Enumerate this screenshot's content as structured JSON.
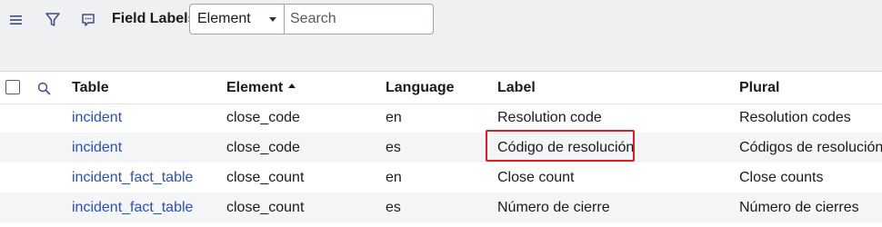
{
  "toolbar": {
    "menu_icon": "hamburger-menu-icon",
    "filter_icon": "funnel-filter-icon",
    "comment_icon": "comment-icon",
    "title": "Field Labels",
    "field_select_value": "Element",
    "search_placeholder": "Search"
  },
  "table": {
    "columns": [
      "Table",
      "Element",
      "Language",
      "Label",
      "Plural"
    ],
    "sort_column": "Element",
    "sort_direction": "ascending",
    "rows": [
      {
        "table": "incident",
        "element": "close_code",
        "language": "en",
        "label": "Resolution code",
        "plural": "Resolution codes"
      },
      {
        "table": "incident",
        "element": "close_code",
        "language": "es",
        "label": "Código de resolución",
        "plural": "Códigos de resolución"
      },
      {
        "table": "incident_fact_table",
        "element": "close_count",
        "language": "en",
        "label": "Close count",
        "plural": "Close counts"
      },
      {
        "table": "incident_fact_table",
        "element": "close_count",
        "language": "es",
        "label": "Número de cierre",
        "plural": "Número de cierres"
      }
    ]
  },
  "colors": {
    "link": "#2a4fbf",
    "toolbar_bg": "#eef0f2",
    "highlight": "#e21d1d",
    "alt_row": "#f4f5f7"
  }
}
